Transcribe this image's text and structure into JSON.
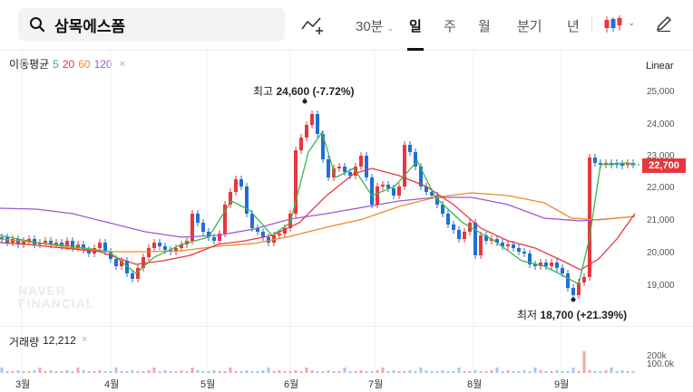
{
  "search": {
    "query": "삼목에스폼"
  },
  "tabs": [
    {
      "label": "30분",
      "dropdown": true
    },
    {
      "label": "일",
      "active": true
    },
    {
      "label": "주"
    },
    {
      "label": "월"
    },
    {
      "label": "분기"
    },
    {
      "label": "년"
    }
  ],
  "icons": {
    "search": "search-icon",
    "draw": "draw-tool-icon",
    "candle": "candlestick-chart-type-icon",
    "pencil": "pencil-edit-icon"
  },
  "ma_legend": {
    "label": "이동평균",
    "periods": [
      {
        "value": "5",
        "color": "#3ab54a"
      },
      {
        "value": "20",
        "color": "#e8363f"
      },
      {
        "value": "60",
        "color": "#f08a24"
      },
      {
        "value": "120",
        "color": "#9b59d0"
      }
    ],
    "close": "×"
  },
  "scale": {
    "label": "Linear"
  },
  "annotations": {
    "high": {
      "prefix": "최고",
      "value": "24,600 (-7.72%)"
    },
    "low": {
      "prefix": "최저",
      "value": "18,700 (+21.39%)"
    }
  },
  "current_price": "22,700",
  "volume": {
    "label": "거래량",
    "value": "12,212",
    "close": "×"
  },
  "watermark": {
    "line1": "NAVER",
    "line2": "FINANCIAL"
  },
  "colors": {
    "up": "#e8363f",
    "down": "#1f6fd8"
  },
  "chart_data": {
    "type": "candlestick",
    "price_axis": {
      "ticks": [
        "25,000",
        "24,000",
        "23,000",
        "22,000",
        "21,000",
        "20,000",
        "19,000"
      ],
      "ylim": [
        18500,
        25400
      ]
    },
    "volume_axis": {
      "ticks": [
        "200k",
        "100.0k"
      ]
    },
    "x_ticks": [
      "3월",
      "4월",
      "5월",
      "6월",
      "7월",
      "8월",
      "9월"
    ],
    "high": 24600,
    "low": 18700,
    "last": 22700
  }
}
